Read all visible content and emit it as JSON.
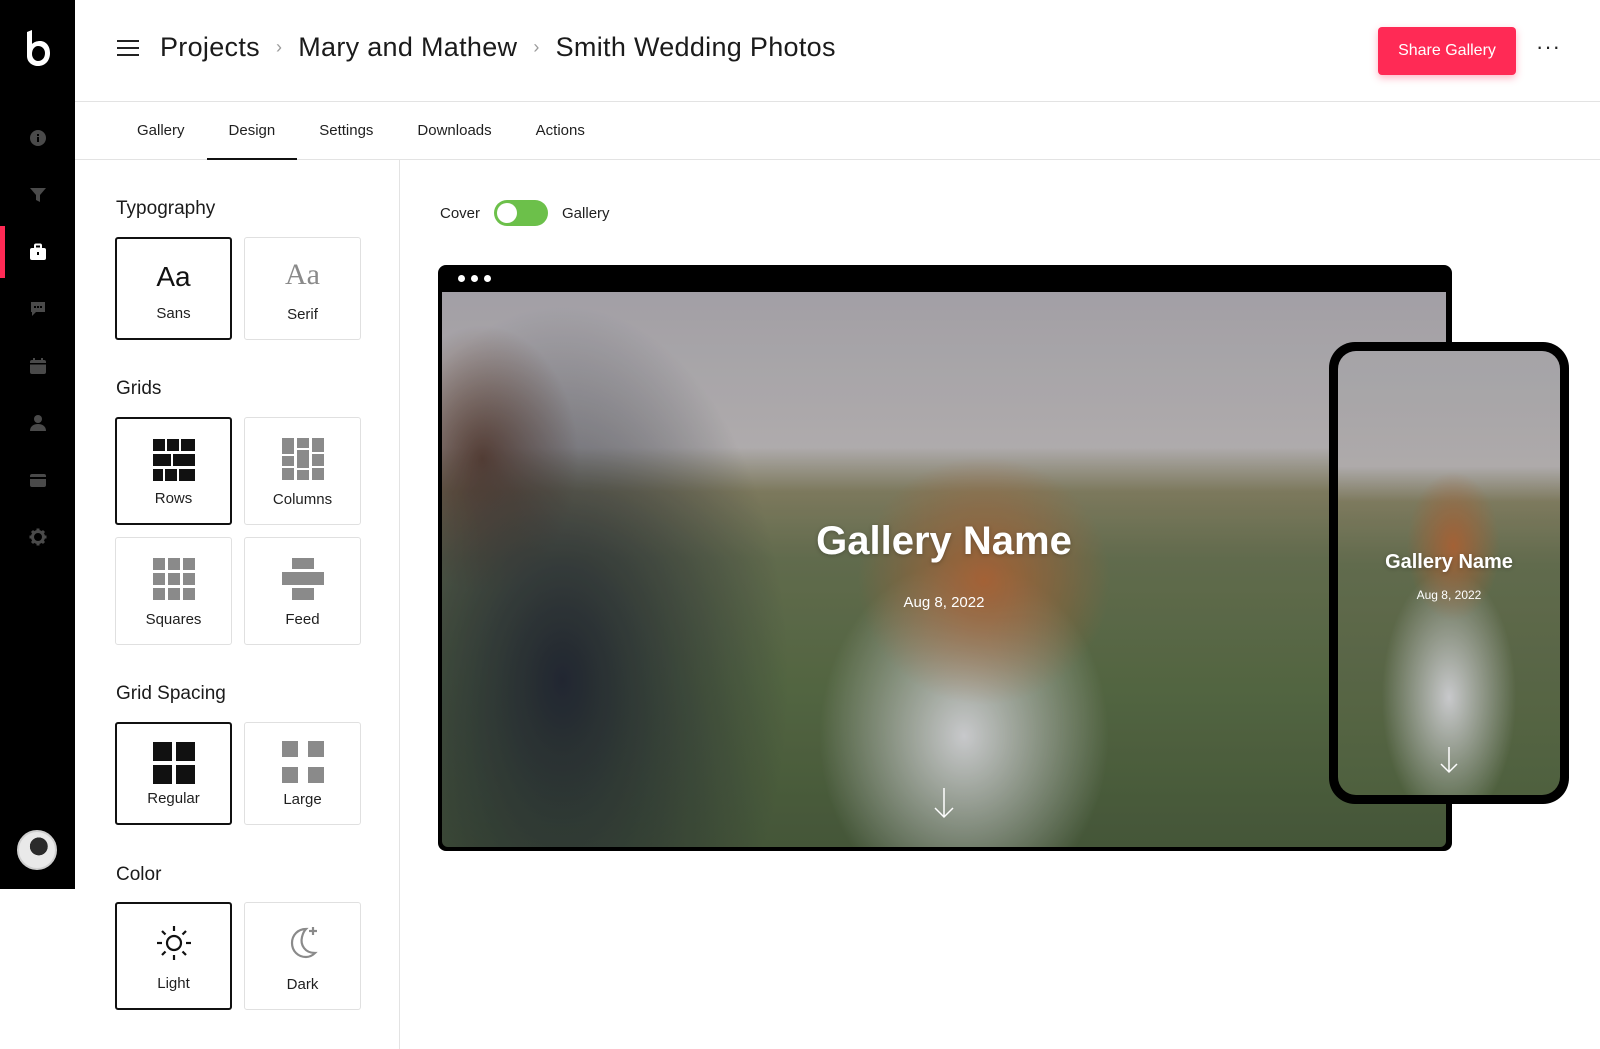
{
  "breadcrumb": [
    "Projects",
    "Mary and Mathew",
    "Smith Wedding Photos"
  ],
  "header": {
    "share_label": "Share Gallery",
    "more_label": "···"
  },
  "tabs": [
    "Gallery",
    "Design",
    "Settings",
    "Downloads",
    "Actions"
  ],
  "active_tab": "Design",
  "rail": {
    "items": [
      "info-icon",
      "filter-icon",
      "briefcase-icon",
      "chat-icon",
      "calendar-icon",
      "user-icon",
      "card-icon",
      "gear-icon"
    ],
    "active_index": 2,
    "accent": "#ff2a55"
  },
  "design": {
    "typography": {
      "title": "Typography",
      "sans_glyph": "Aa",
      "sans": "Sans",
      "serif_glyph": "Aa",
      "serif": "Serif",
      "selected": "Sans"
    },
    "grids": {
      "title": "Grids",
      "rows": "Rows",
      "columns": "Columns",
      "squares": "Squares",
      "feed": "Feed",
      "selected": "Rows"
    },
    "spacing": {
      "title": "Grid Spacing",
      "regular": "Regular",
      "large": "Large",
      "selected": "Regular"
    },
    "color": {
      "title": "Color",
      "light": "Light",
      "dark": "Dark",
      "selected": "Light"
    }
  },
  "preview": {
    "toggle_left": "Cover",
    "toggle_right": "Gallery",
    "toggle_color": "#6cc04a",
    "gallery_name": "Gallery Name",
    "gallery_date": "Aug 8, 2022"
  }
}
